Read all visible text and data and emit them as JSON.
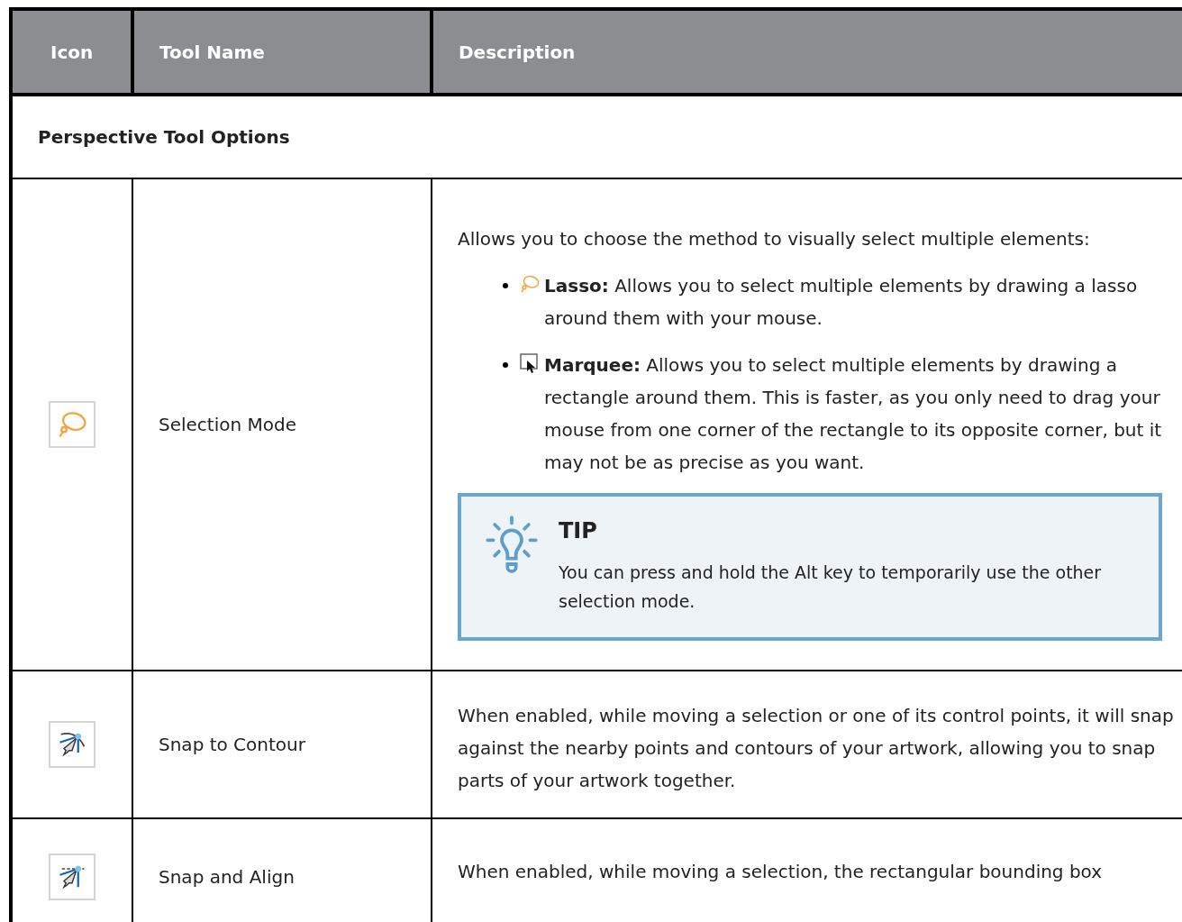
{
  "table": {
    "columns": [
      "Icon",
      "Tool Name",
      "Description"
    ],
    "section_title": "Perspective Tool Options",
    "rows": [
      {
        "kind": "lasso",
        "name": "Selection Mode",
        "description": [
          {
            "kind": "paragraph",
            "text": "Allows you to choose the method to visually select multiple elements:"
          },
          {
            "kind": "bullets",
            "items": [
              {
                "kind": "lasso",
                "text": "**Lasso:** Allows you to select multiple elements by drawing a lasso around them with your mouse."
              },
              {
                "kind": "marquee",
                "text": "**Marquee:** Allows you to select multiple elements by drawing a rectangle around them. This is faster, as you only need to drag your mouse from one corner of the rectangle to its opposite corner, but it may not be as precise as you want."
              }
            ]
          },
          {
            "kind": "tip",
            "title": "TIP",
            "text": "You can press and hold the Alt key to temporarily use the other selection mode."
          }
        ]
      },
      {
        "kind": "contour",
        "name": "Snap to Contour",
        "description": [
          {
            "kind": "paragraph",
            "text": "When enabled, while moving a selection or one of its control points, it will snap against the nearby points and contours of your artwork, allowing you to snap parts of your artwork together."
          }
        ]
      },
      {
        "kind": "align",
        "name": "Snap and Align",
        "description": [
          {
            "kind": "paragraph",
            "text": "When enabled, while moving a selection, the rectangular bounding box"
          }
        ]
      }
    ]
  }
}
